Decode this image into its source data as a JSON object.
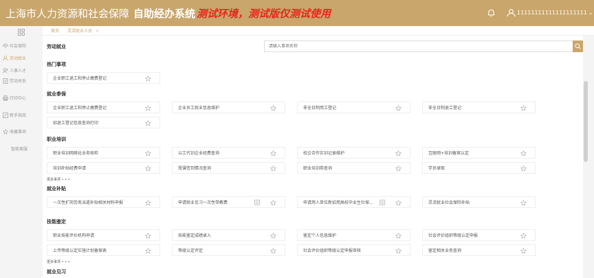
{
  "header": {
    "title_main": "上海市人力资源和社会保障",
    "title_sub": "自助经办系统",
    "title_warning": "测试环境，测试版仅测试使用",
    "username": "11111111111111111111"
  },
  "sidebar": {
    "items": [
      {
        "label": "社会保险"
      },
      {
        "label": "劳动就业"
      },
      {
        "label": "人事人才"
      },
      {
        "label": "劳动关系"
      },
      {
        "label": "打印中心"
      },
      {
        "label": "新手指南"
      },
      {
        "label": "收藏事项"
      },
      {
        "label": "智能客服"
      }
    ]
  },
  "tabs": [
    {
      "label": "首页"
    },
    {
      "label": "灵活就业人员"
    }
  ],
  "main": {
    "page_label": "劳动就业",
    "search_placeholder": "请输入事项名称",
    "more_label": "更多事项 • • •",
    "sections": [
      {
        "title": "热门事项",
        "cards": [
          "企业职工退工和停止缴费登记"
        ]
      },
      {
        "title": "就业参保",
        "cards": [
          "企业职工退工和停止缴费登记",
          "企业员工就业信息维护",
          "非全日制用工登记",
          "非全日制退工登记",
          "招退工登记信息查询打印"
        ]
      },
      {
        "title": "职业培训",
        "cards": [
          "职业培训网络化业务核检",
          "以工代训企业经费查询",
          "校企合作实训记录维护",
          "互联网+培训备案认定",
          "培训补贴经费申请",
          "授课签到情况查询",
          "职业培训券查询",
          "学员录取"
        ]
      },
      {
        "title": "就业补贴",
        "cards": [
          "一次性扩岗劳务派遣补贴相关材料申报",
          "申请就业见习一次性带教费",
          "申请用人单位新招用高校毕业生社保...",
          "灵活就业社会保险补贴"
        ]
      },
      {
        "title": "技能鉴定",
        "cards": [
          "职业技能评价机构申请",
          "技能鉴定成绩录入",
          "鉴定个人信息维护",
          "社会评价组织等级认定申报",
          "上传等级认定实施计划备案表",
          "等级认定评定",
          "社会评价组织等级认定申报审核",
          "鉴定相关业务查询"
        ]
      },
      {
        "title": "就业见习",
        "cards": []
      }
    ]
  },
  "colors": {
    "brand": "#c9a66b",
    "warning": "#e8261c"
  }
}
